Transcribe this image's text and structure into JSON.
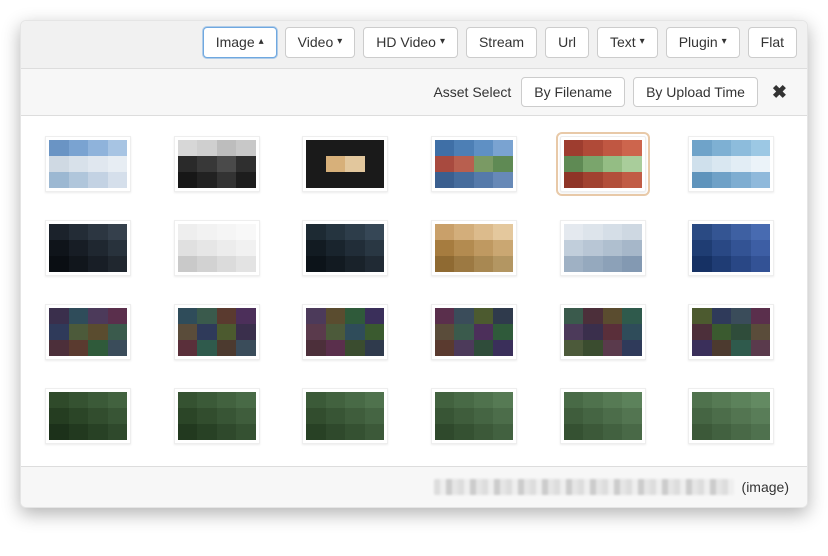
{
  "tabs": [
    {
      "label": "Image",
      "caret": "▴",
      "active": true
    },
    {
      "label": "Video",
      "caret": "▾",
      "active": false
    },
    {
      "label": "HD Video",
      "caret": "▾",
      "active": false
    },
    {
      "label": "Stream",
      "caret": "",
      "active": false
    },
    {
      "label": "Url",
      "caret": "",
      "active": false
    },
    {
      "label": "Text",
      "caret": "▾",
      "active": false
    },
    {
      "label": "Plugin",
      "caret": "▾",
      "active": false
    },
    {
      "label": "Flat",
      "caret": "",
      "active": false
    }
  ],
  "sort": {
    "label": "Asset Select",
    "by_filename": "By Filename",
    "by_upload": "By Upload Time"
  },
  "footer": {
    "type_suffix": "(image)"
  },
  "thumbs": [
    {
      "sel": false,
      "c": [
        "#6a94c4",
        "#7aa3d1",
        "#8fb3db",
        "#a7c4e3",
        "#cfd9e3",
        "#d8e1ea",
        "#e0e7ef",
        "#e7edf3",
        "#9cb8d2",
        "#b0c6db",
        "#c3d2e3",
        "#d5dfeb"
      ]
    },
    {
      "sel": false,
      "c": [
        "#d7d7d7",
        "#cfcfcf",
        "#bdbdbd",
        "#c8c8c8",
        "#2a2a2a",
        "#383838",
        "#4a4a4a",
        "#2f2f2f",
        "#171717",
        "#222222",
        "#333333",
        "#1d1d1d"
      ]
    },
    {
      "sel": false,
      "c": [
        "#1a1a1a",
        "#1a1a1a",
        "#1a1a1a",
        "#1a1a1a",
        "#1a1a1a",
        "#d7b07a",
        "#e2c79d",
        "#1a1a1a",
        "#1a1a1a",
        "#1a1a1a",
        "#1a1a1a",
        "#1a1a1a"
      ]
    },
    {
      "sel": false,
      "c": [
        "#3f6fa6",
        "#4d7fb5",
        "#5f90c4",
        "#7aa3d1",
        "#a84a3f",
        "#b85f4f",
        "#7a9a64",
        "#5f8a54",
        "#3b5f8f",
        "#466c9c",
        "#557aaa",
        "#6789b7"
      ]
    },
    {
      "sel": true,
      "c": [
        "#9e3d2f",
        "#b04a38",
        "#c05742",
        "#cd654d",
        "#5f8a54",
        "#7aa56c",
        "#94bd84",
        "#a9cd9b",
        "#8f3527",
        "#a14230",
        "#b24f3a",
        "#c15c45"
      ]
    },
    {
      "sel": false,
      "c": [
        "#6fa3c9",
        "#7eb0d3",
        "#8dbcdc",
        "#9cc8e4",
        "#cfe0ec",
        "#d9e7f1",
        "#e2edf5",
        "#ebf3f9",
        "#5f94bc",
        "#6fa1c7",
        "#7eadd1",
        "#8fb9db"
      ]
    },
    {
      "sel": false,
      "c": [
        "#1b222b",
        "#232c36",
        "#2c3641",
        "#35404c",
        "#0f141a",
        "#171d25",
        "#1f2730",
        "#28323c",
        "#0a0e13",
        "#11161c",
        "#181e26",
        "#20272f"
      ]
    },
    {
      "sel": false,
      "c": [
        "#eeeeee",
        "#f2f2f2",
        "#f5f5f5",
        "#f8f8f8",
        "#e0e0e0",
        "#e6e6e6",
        "#ececec",
        "#f1f1f1",
        "#c9c9c9",
        "#d2d2d2",
        "#dbdbdb",
        "#e3e3e3"
      ]
    },
    {
      "sel": false,
      "c": [
        "#1d2a33",
        "#25343f",
        "#2d3d4a",
        "#364756",
        "#121b22",
        "#19242d",
        "#212d38",
        "#293743",
        "#0c1319",
        "#121a21",
        "#19222a",
        "#202a34"
      ]
    },
    {
      "sel": false,
      "c": [
        "#c9a06a",
        "#d3ae7b",
        "#dcbb8c",
        "#e4c89d",
        "#a67c3f",
        "#b38b50",
        "#bf9961",
        "#caa772",
        "#8f6a32",
        "#9c7942",
        "#a88852",
        "#b39662"
      ]
    },
    {
      "sel": false,
      "c": [
        "#e4e9ef",
        "#dde4eb",
        "#d5dee7",
        "#ced8e2",
        "#c1cedb",
        "#b8c6d5",
        "#afbfcf",
        "#a6b7c9",
        "#9fb1c4",
        "#95a9be",
        "#8ca1b8",
        "#8399b2"
      ]
    },
    {
      "sel": false,
      "c": [
        "#2a4a83",
        "#345593",
        "#3e60a2",
        "#486bb1",
        "#1f3d73",
        "#294884",
        "#335394",
        "#3d5ea4",
        "#163164",
        "#1f3c74",
        "#294785",
        "#335295"
      ]
    },
    {
      "sel": false,
      "c": [
        "#3a2f4c",
        "#2f4c5a",
        "#4c3a5a",
        "#5a2f4c",
        "#2f3a5a",
        "#4c5a3a",
        "#5a4c2f",
        "#3a5a4c",
        "#4c2f3a",
        "#5a3a2f",
        "#2f5a3a",
        "#3a4c5a"
      ]
    },
    {
      "sel": false,
      "c": [
        "#2f4c5a",
        "#3a5a4c",
        "#5a3a2f",
        "#4c2f5a",
        "#5a4c3a",
        "#2f3a5a",
        "#4c5a2f",
        "#3a2f4c",
        "#5a2f3a",
        "#2f5a4c",
        "#4c3a2f",
        "#3a4c5a"
      ]
    },
    {
      "sel": false,
      "c": [
        "#4c3a5a",
        "#5a4c2f",
        "#2f5a3a",
        "#3a2f5a",
        "#5a3a4c",
        "#4c5a3a",
        "#2f4c5a",
        "#3a5a2f",
        "#4c2f3a",
        "#5a2f4c",
        "#3a4c2f",
        "#2f3a4c"
      ]
    },
    {
      "sel": false,
      "c": [
        "#5a2f4c",
        "#3a4c5a",
        "#4c5a2f",
        "#2f3a4c",
        "#5a4c3a",
        "#3a5a4c",
        "#4c2f5a",
        "#2f5a3a",
        "#5a3a2f",
        "#4c3a5a",
        "#2f4c3a",
        "#3a2f5a"
      ]
    },
    {
      "sel": false,
      "c": [
        "#3a5a4c",
        "#4c2f3a",
        "#5a4c2f",
        "#2f5a4c",
        "#4c3a5a",
        "#3a2f4c",
        "#5a2f3a",
        "#2f4c5a",
        "#4c5a3a",
        "#3a4c2f",
        "#5a3a4c",
        "#2f3a5a"
      ]
    },
    {
      "sel": false,
      "c": [
        "#4c5a2f",
        "#2f3a5a",
        "#3a4c5a",
        "#5a2f4c",
        "#4c2f3a",
        "#3a5a2f",
        "#2f4c3a",
        "#5a4c3a",
        "#3a2f5a",
        "#4c3a2f",
        "#2f5a4c",
        "#5a3a4c"
      ]
    },
    {
      "sel": false,
      "c": [
        "#2f4a2a",
        "#355231",
        "#3b5a38",
        "#42623f",
        "#253d21",
        "#2b4527",
        "#324d2e",
        "#385535",
        "#1c311a",
        "#22391f",
        "#284125",
        "#2f492c"
      ]
    },
    {
      "sel": false,
      "c": [
        "#355231",
        "#3b5a38",
        "#42623f",
        "#486a46",
        "#2b4527",
        "#324d2e",
        "#385535",
        "#3f5d3c",
        "#22391f",
        "#284125",
        "#2f492c",
        "#355132"
      ]
    },
    {
      "sel": false,
      "c": [
        "#3b5a38",
        "#42623f",
        "#486a46",
        "#4f724d",
        "#324d2e",
        "#385535",
        "#3f5d3c",
        "#456543",
        "#284125",
        "#2f492c",
        "#355132",
        "#3c5939"
      ]
    },
    {
      "sel": false,
      "c": [
        "#42623f",
        "#486a46",
        "#4f724d",
        "#567a54",
        "#385535",
        "#3f5d3c",
        "#456543",
        "#4c6d4a",
        "#2f492c",
        "#355132",
        "#3c5939",
        "#426140"
      ]
    },
    {
      "sel": false,
      "c": [
        "#486a46",
        "#4f724d",
        "#567a54",
        "#5c825b",
        "#3f5d3c",
        "#456543",
        "#4c6d4a",
        "#537551",
        "#355132",
        "#3c5939",
        "#426140",
        "#496947"
      ]
    },
    {
      "sel": false,
      "c": [
        "#4f724d",
        "#567a54",
        "#5c825b",
        "#638a62",
        "#456543",
        "#4c6d4a",
        "#537551",
        "#597d58",
        "#3c5939",
        "#426140",
        "#496947",
        "#4f714e"
      ]
    }
  ]
}
